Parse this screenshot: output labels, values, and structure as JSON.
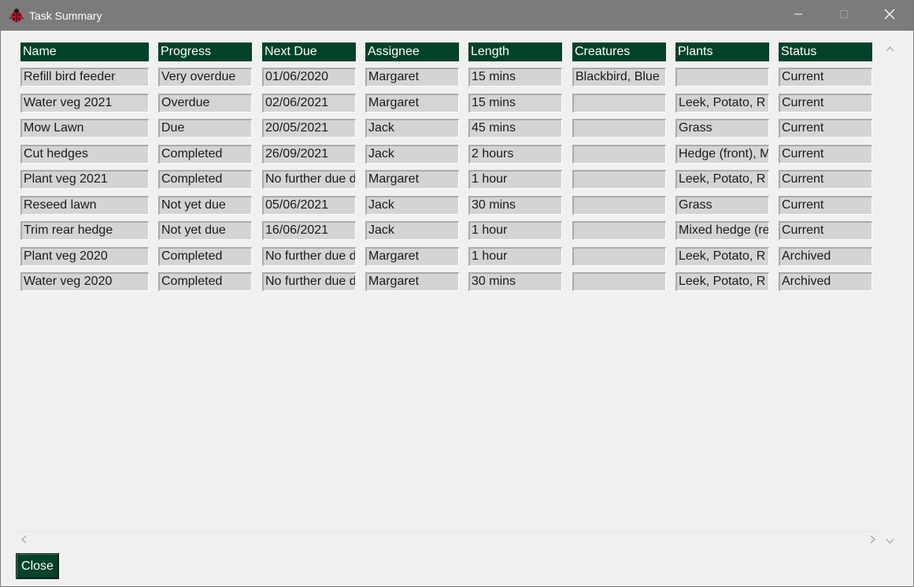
{
  "window": {
    "title": "Task Summary"
  },
  "table": {
    "headers": [
      "Name",
      "Progress",
      "Next Due",
      "Assignee",
      "Length",
      "Creatures",
      "Plants",
      "Status"
    ],
    "rows": [
      [
        "Refill bird feeder",
        "Very overdue",
        "01/06/2020",
        "Margaret",
        "15 mins",
        "Blackbird, Blue",
        "",
        "Current"
      ],
      [
        "Water veg 2021",
        "Overdue",
        "02/06/2021",
        "Margaret",
        "15 mins",
        "",
        "Leek, Potato, R",
        "Current"
      ],
      [
        "Mow Lawn",
        "Due",
        "20/05/2021",
        "Jack",
        "45 mins",
        "",
        "Grass",
        "Current"
      ],
      [
        "Cut hedges",
        "Completed",
        "26/09/2021",
        "Jack",
        "2 hours",
        "",
        "Hedge (front), M",
        "Current"
      ],
      [
        "Plant veg 2021",
        "Completed",
        "No further due d",
        "Margaret",
        "1 hour",
        "",
        "Leek, Potato, R",
        "Current"
      ],
      [
        "Reseed lawn",
        "Not yet due",
        "05/06/2021",
        "Jack",
        "30 mins",
        "",
        "Grass",
        "Current"
      ],
      [
        "Trim rear hedge",
        "Not yet due",
        "16/06/2021",
        "Jack",
        "1 hour",
        "",
        "Mixed hedge (re",
        "Current"
      ],
      [
        "Plant veg 2020",
        "Completed",
        "No further due d",
        "Margaret",
        "1 hour",
        "",
        "Leek, Potato, R",
        "Archived"
      ],
      [
        "Water veg 2020",
        "Completed",
        "No further due d",
        "Margaret",
        "30 mins",
        "",
        "Leek, Potato, R",
        "Archived"
      ]
    ]
  },
  "buttons": {
    "close_label": "Close"
  },
  "colors": {
    "header_bg": "#024228",
    "titlebar_bg": "#7b7b7b",
    "cell_bg": "#d4d4d4"
  },
  "icons": {
    "app": "ladybird-icon",
    "minimize": "minimize-icon",
    "maximize": "maximize-icon",
    "close": "close-icon"
  }
}
